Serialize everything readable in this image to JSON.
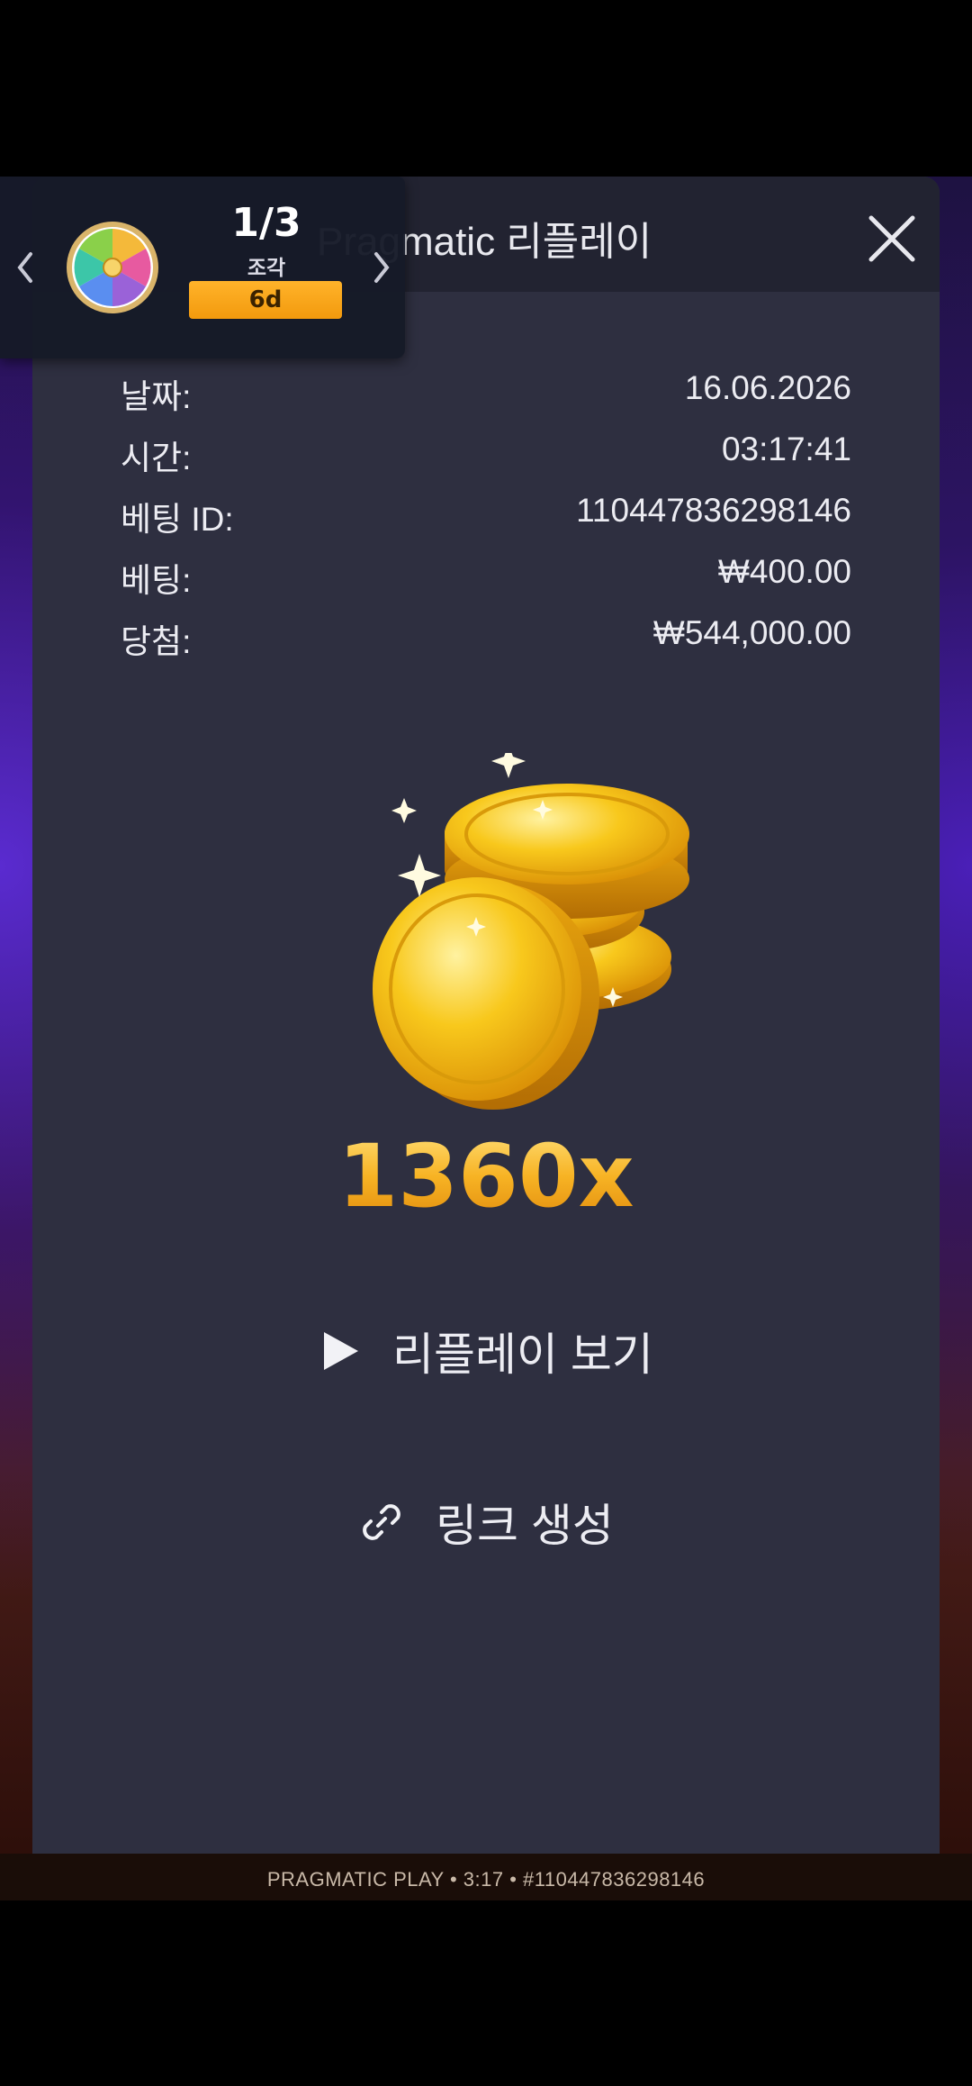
{
  "modal": {
    "title": "Pragmatic 리플레이",
    "rows": [
      {
        "label": "날짜:",
        "value": "16.06.2026"
      },
      {
        "label": "시간:",
        "value": "03:17:41"
      },
      {
        "label": "베팅 ID:",
        "value": "110447836298146"
      },
      {
        "label": "베팅:",
        "value": "₩400.00"
      },
      {
        "label": "당첨:",
        "value": "₩544,000.00"
      }
    ],
    "multiplier": "1360x",
    "watch_replay_label": "리플레이 보기",
    "create_link_label": "링크 생성"
  },
  "widget": {
    "count": "1/3",
    "unit": "조각",
    "timer": "6d"
  },
  "footer": {
    "text": "PRAGMATIC PLAY • 3:17 • #110447836298146"
  },
  "colors": {
    "modal_bg": "#2e2f40",
    "header_bg": "#222331",
    "accent_gold": "#f5a617",
    "timer_orange": "#f39a0d"
  }
}
